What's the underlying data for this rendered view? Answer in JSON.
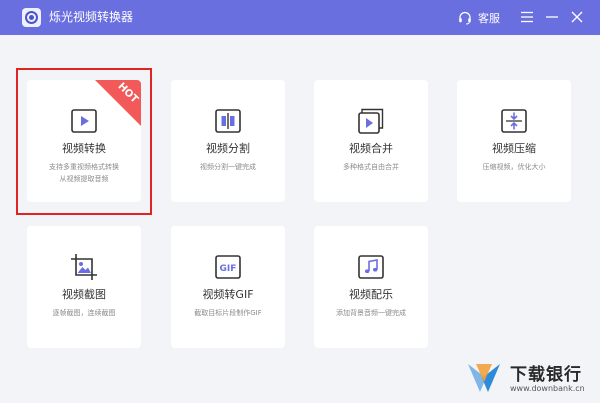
{
  "window": {
    "title": "烁光视频转换器",
    "support_label": "客服",
    "accent_color": "#6a6fe0"
  },
  "tools": [
    {
      "name": "视频转换",
      "desc": "支持多重视频格式转换",
      "desc2": "从视频提取音频",
      "icon": "video-play-icon",
      "badge": "HOT",
      "highlighted": true
    },
    {
      "name": "视频分割",
      "desc": "视频分割一键完成",
      "icon": "split-icon"
    },
    {
      "name": "视频合并",
      "desc": "多种格式自由合并",
      "icon": "merge-icon"
    },
    {
      "name": "视频压缩",
      "desc": "压缩视频，优化大小",
      "icon": "compress-icon"
    },
    {
      "name": "视频截图",
      "desc": "逐帧截图，连续截图",
      "icon": "crop-image-icon"
    },
    {
      "name": "视频转GIF",
      "desc": "截取目标片段制作GIF",
      "icon": "gif-icon",
      "icon_text": "GIF"
    },
    {
      "name": "视频配乐",
      "desc": "添加背景音频一键完成",
      "icon": "music-icon"
    }
  ],
  "watermark": {
    "name": "下载银行",
    "url": "www.downbank.cn"
  }
}
